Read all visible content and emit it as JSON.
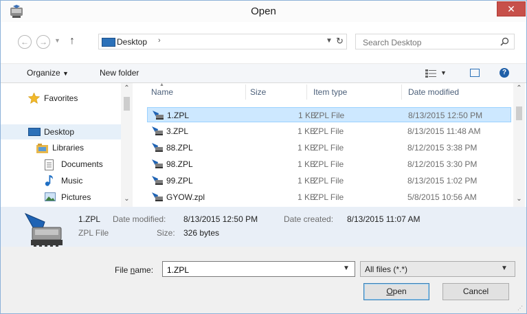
{
  "window": {
    "title": "Open"
  },
  "navigation": {
    "breadcrumb": "Desktop"
  },
  "search": {
    "placeholder": "Search Desktop"
  },
  "toolbar": {
    "organize_label": "Organize",
    "new_folder_label": "New folder"
  },
  "nav_pane": {
    "items": [
      {
        "label": "Favorites",
        "icon": "star-icon"
      },
      {
        "label": "Desktop",
        "icon": "desktop-icon",
        "selected": true
      },
      {
        "label": "Libraries",
        "icon": "libraries-icon"
      },
      {
        "label": "Documents",
        "icon": "documents-icon"
      },
      {
        "label": "Music",
        "icon": "music-icon"
      },
      {
        "label": "Pictures",
        "icon": "pictures-icon"
      }
    ]
  },
  "file_list": {
    "columns": [
      "Name",
      "Size",
      "Item type",
      "Date modified"
    ],
    "rows": [
      {
        "name": "1.ZPL",
        "size": "1 KB",
        "type": "ZPL File",
        "modified": "8/13/2015 12:50 PM",
        "selected": true
      },
      {
        "name": "3.ZPL",
        "size": "1 KB",
        "type": "ZPL File",
        "modified": "8/13/2015 11:48 AM"
      },
      {
        "name": "88.ZPL",
        "size": "1 KB",
        "type": "ZPL File",
        "modified": "8/12/2015 3:38 PM"
      },
      {
        "name": "98.ZPL",
        "size": "1 KB",
        "type": "ZPL File",
        "modified": "8/12/2015 3:30 PM"
      },
      {
        "name": "99.ZPL",
        "size": "1 KB",
        "type": "ZPL File",
        "modified": "8/13/2015 1:02 PM"
      },
      {
        "name": "GYOW.zpl",
        "size": "1 KB",
        "type": "ZPL File",
        "modified": "5/8/2015 10:56 AM"
      }
    ]
  },
  "details": {
    "name": "1.ZPL",
    "type": "ZPL File",
    "modified_label": "Date modified:",
    "modified_value": "8/13/2015 12:50 PM",
    "created_label": "Date created:",
    "created_value": "8/13/2015 11:07 AM",
    "size_label": "Size:",
    "size_value": "326 bytes"
  },
  "bottom": {
    "file_name_label_pre": "File ",
    "file_name_label_key": "n",
    "file_name_label_post": "ame:",
    "file_name_value": "1.ZPL",
    "filter_value": "All files (*.*)",
    "open_label_key": "O",
    "open_label_post": "pen",
    "cancel_label": "Cancel"
  },
  "colors": {
    "accent": "#2b71b8",
    "selection": "#cde8ff",
    "close": "#c7504a"
  }
}
